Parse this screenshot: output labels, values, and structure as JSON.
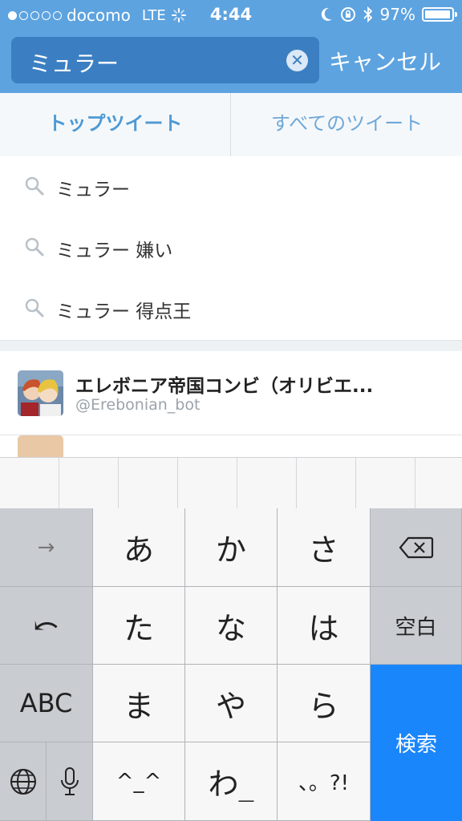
{
  "status": {
    "carrier": "docomo",
    "network": "LTE",
    "time": "4:44",
    "battery": "97%",
    "battery_level": 0.97,
    "signal_bars": 1
  },
  "search": {
    "query": "ミュラー",
    "cancel_label": "キャンセル"
  },
  "tabs": [
    {
      "label": "トップツイート",
      "selected": true
    },
    {
      "label": "すべてのツイート",
      "selected": false
    }
  ],
  "suggestions": [
    {
      "label": "ミュラー"
    },
    {
      "label": "ミュラー 嫌い"
    },
    {
      "label": "ミュラー 得点王"
    }
  ],
  "user_result": {
    "name": "エレボニア帝国コンビ（オリビエ...",
    "handle": "@Erebonian_bot"
  },
  "keyboard": {
    "arrow": "→",
    "undo": "⤺",
    "abc": "ABC",
    "globe": "globe-icon",
    "mic": "mic-icon",
    "k_a": "あ",
    "k_ka": "か",
    "k_sa": "さ",
    "k_ta": "た",
    "k_na": "な",
    "k_ha": "は",
    "k_ma": "ま",
    "k_ya": "や",
    "k_ra": "ら",
    "k_face": "^_^",
    "k_wa": "わ_",
    "k_punct": "、。?!",
    "space": "空白",
    "search": "検索"
  },
  "colors": {
    "header": "#5da3e0",
    "search_field": "#3b7fc2",
    "accent": "#4d9ad6",
    "enter_key": "#1a86fb"
  }
}
